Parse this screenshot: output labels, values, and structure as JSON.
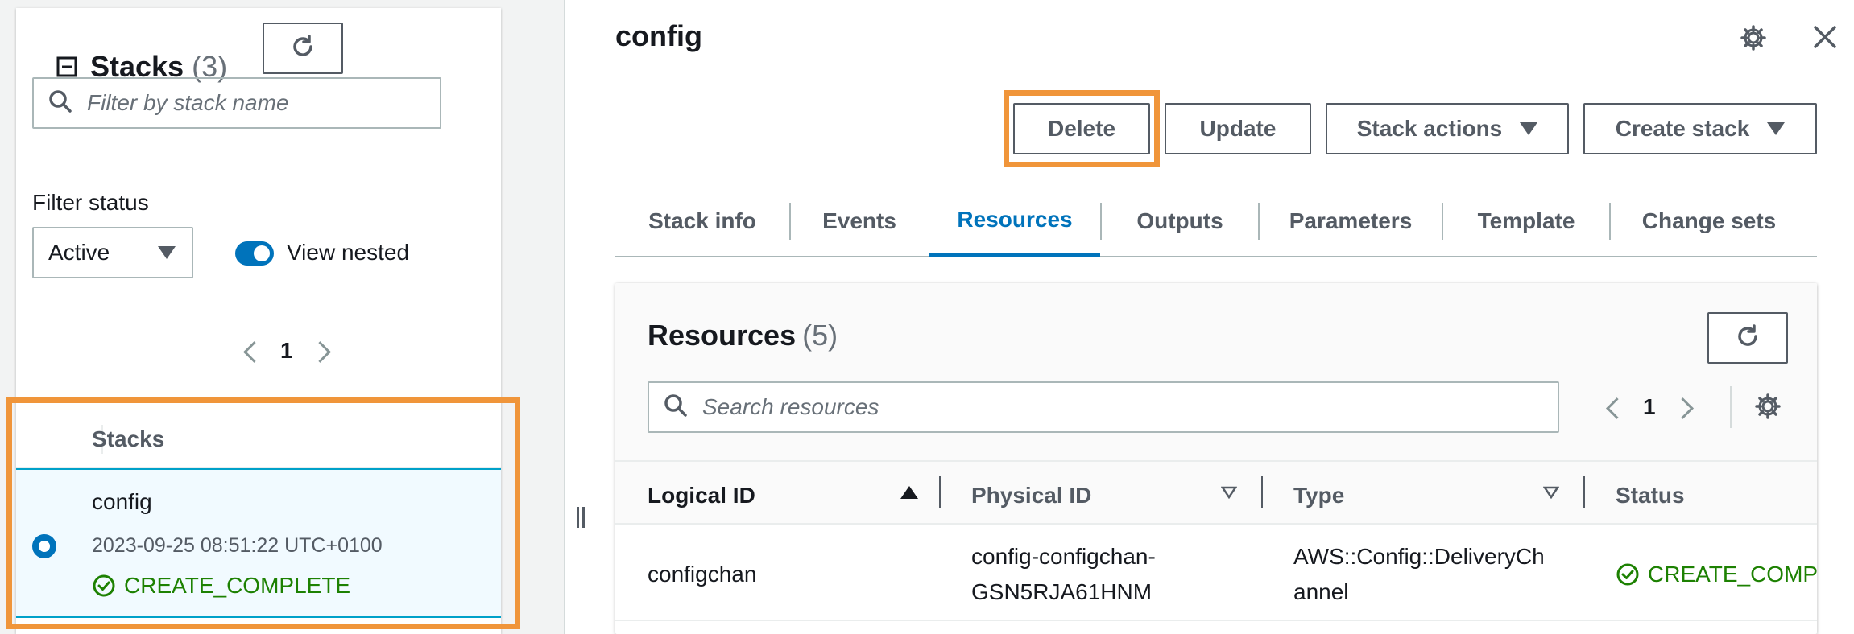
{
  "left": {
    "title": "Stacks",
    "count": "(3)",
    "filter_placeholder": "Filter by stack name",
    "filter_status_label": "Filter status",
    "status_select_value": "Active",
    "view_nested_label": "View nested",
    "view_nested_on": true,
    "page_number": "1",
    "table_header": "Stacks",
    "stacks": [
      {
        "name": "config",
        "created": "2023-09-25 08:51:22 UTC+0100",
        "status": "CREATE_COMPLETE",
        "selected": true
      }
    ]
  },
  "detail": {
    "title": "config",
    "buttons": {
      "delete": "Delete",
      "update": "Update",
      "stack_actions": "Stack actions",
      "create_stack": "Create stack"
    },
    "tabs": [
      "Stack info",
      "Events",
      "Resources",
      "Outputs",
      "Parameters",
      "Template",
      "Change sets"
    ],
    "active_tab": "Resources"
  },
  "resources": {
    "title": "Resources",
    "count": "(5)",
    "search_placeholder": "Search resources",
    "page_number": "1",
    "columns": [
      "Logical ID",
      "Physical ID",
      "Type",
      "Status"
    ],
    "rows": [
      {
        "logical_id": "configchan",
        "physical_id_line1": "config-configchan-",
        "physical_id_line2": "GSN5RJA61HNM",
        "type_line1": "AWS::Config::DeliveryCh",
        "type_line2": "annel",
        "status": "CREATE_COMPLETE"
      }
    ]
  },
  "colors": {
    "accent": "#0073bb",
    "success": "#1d8102",
    "highlight": "#f0953a"
  },
  "icons": [
    "collapse-icon",
    "refresh-icon",
    "search-icon",
    "caret-down-icon",
    "chevron-left-icon",
    "chevron-right-icon",
    "settings-icon",
    "close-icon",
    "status-success-icon",
    "sort-asc-icon",
    "sort-desc-icon",
    "drag-handle-icon"
  ]
}
